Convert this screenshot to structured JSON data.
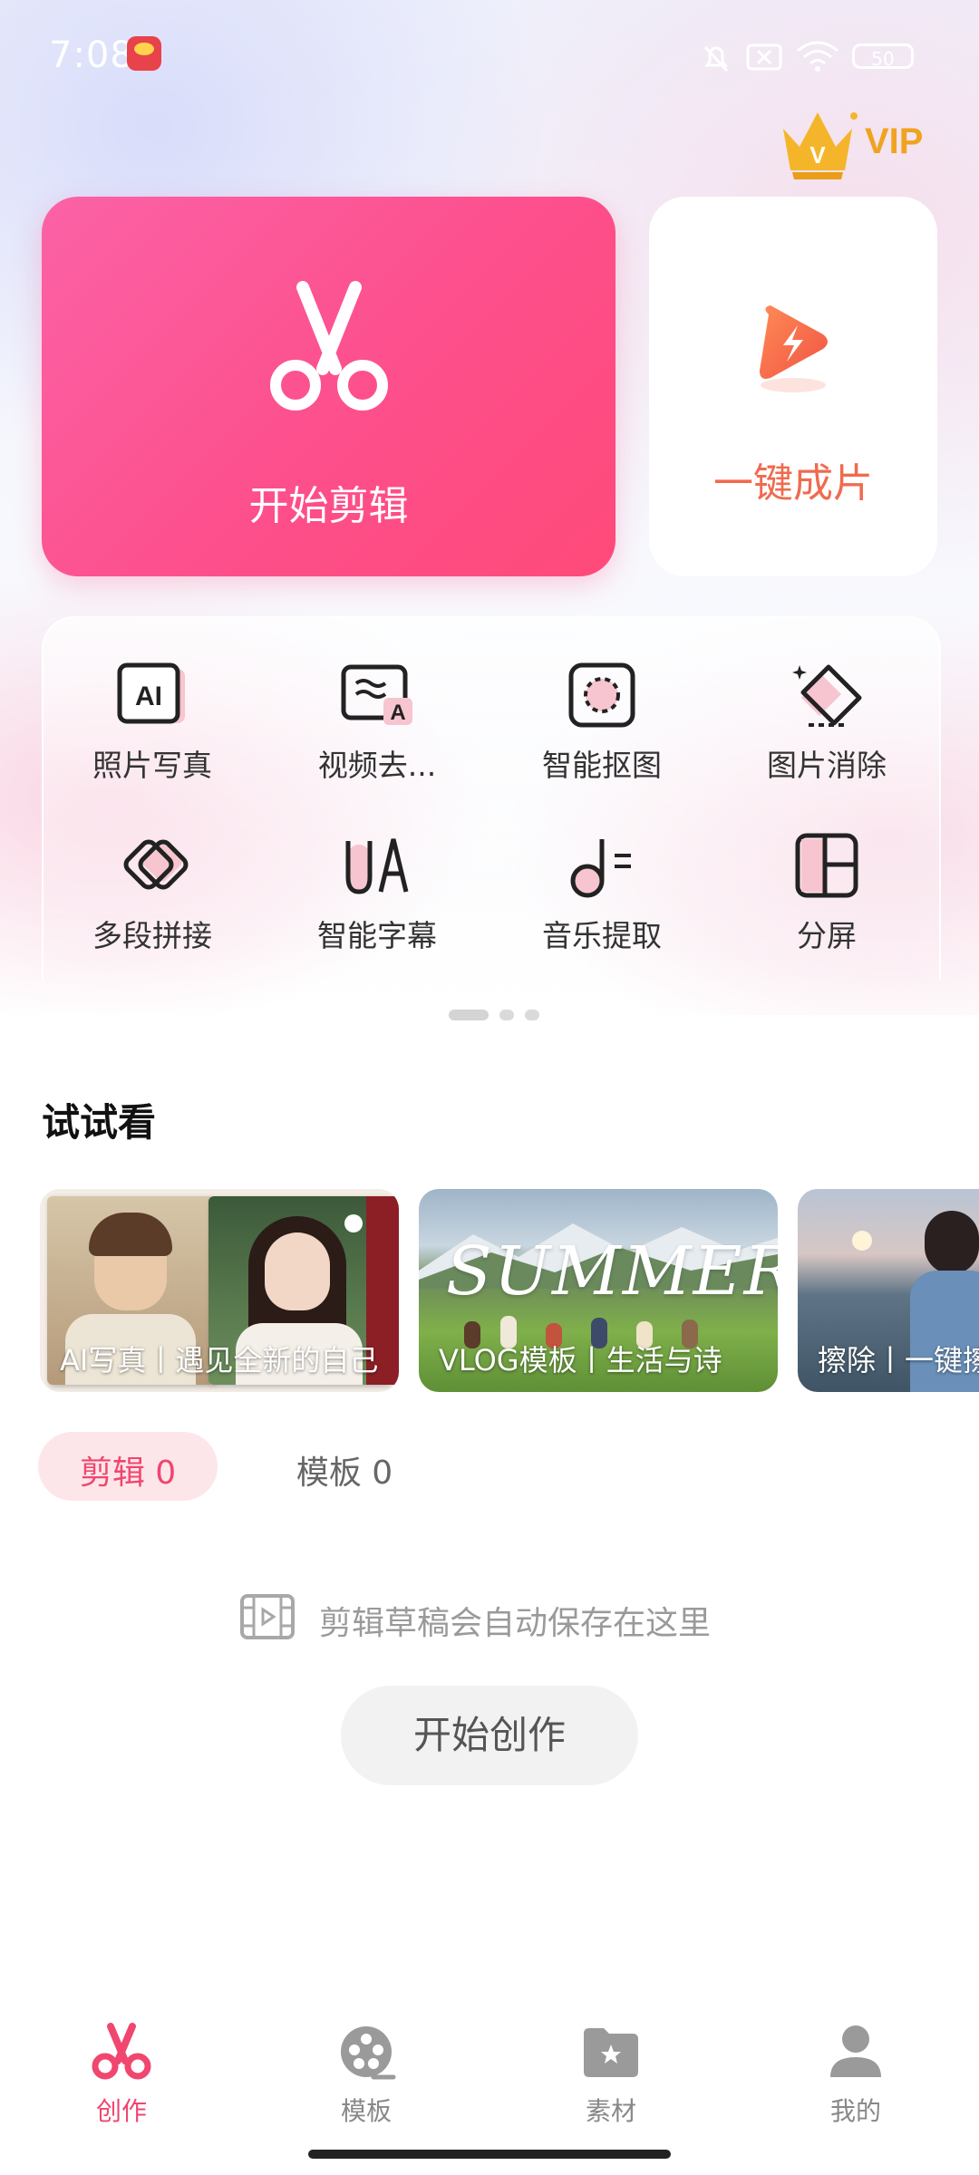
{
  "status_bar": {
    "time": "7:08",
    "battery": "50"
  },
  "vip": {
    "label": "VIP"
  },
  "main_cards": {
    "edit_label": "开始剪辑",
    "one_click_label": "一键成片"
  },
  "tools": [
    {
      "label": "照片写真",
      "icon": "ai-photo-icon"
    },
    {
      "label": "视频去...",
      "icon": "video-text-remove-icon"
    },
    {
      "label": "智能抠图",
      "icon": "cutout-icon"
    },
    {
      "label": "图片消除",
      "icon": "eraser-icon"
    },
    {
      "label": "多段拼接",
      "icon": "merge-icon"
    },
    {
      "label": "智能字幕",
      "icon": "subtitle-icon"
    },
    {
      "label": "音乐提取",
      "icon": "music-extract-icon"
    },
    {
      "label": "分屏",
      "icon": "split-screen-icon"
    }
  ],
  "try_section": {
    "title": "试试看",
    "cards": [
      {
        "label": "AI写真丨遇见全新的自己"
      },
      {
        "label": "VLOG模板丨生活与诗",
        "overlay_text": "SUMMER"
      },
      {
        "label": "擦除丨一键擦"
      }
    ]
  },
  "drafts": {
    "tabs": [
      {
        "label": "剪辑 0"
      },
      {
        "label": "模板 0"
      }
    ],
    "empty_text": "剪辑草稿会自动保存在这里",
    "start_button": "开始创作"
  },
  "bottom_nav": [
    {
      "label": "创作",
      "active": true
    },
    {
      "label": "模板",
      "active": false
    },
    {
      "label": "素材",
      "active": false
    },
    {
      "label": "我的",
      "active": false
    }
  ],
  "colors": {
    "accent": "#f0466f",
    "edit_card": "#fd4f8c",
    "one_click_text": "#f06a4f",
    "vip": "#f0a321"
  }
}
